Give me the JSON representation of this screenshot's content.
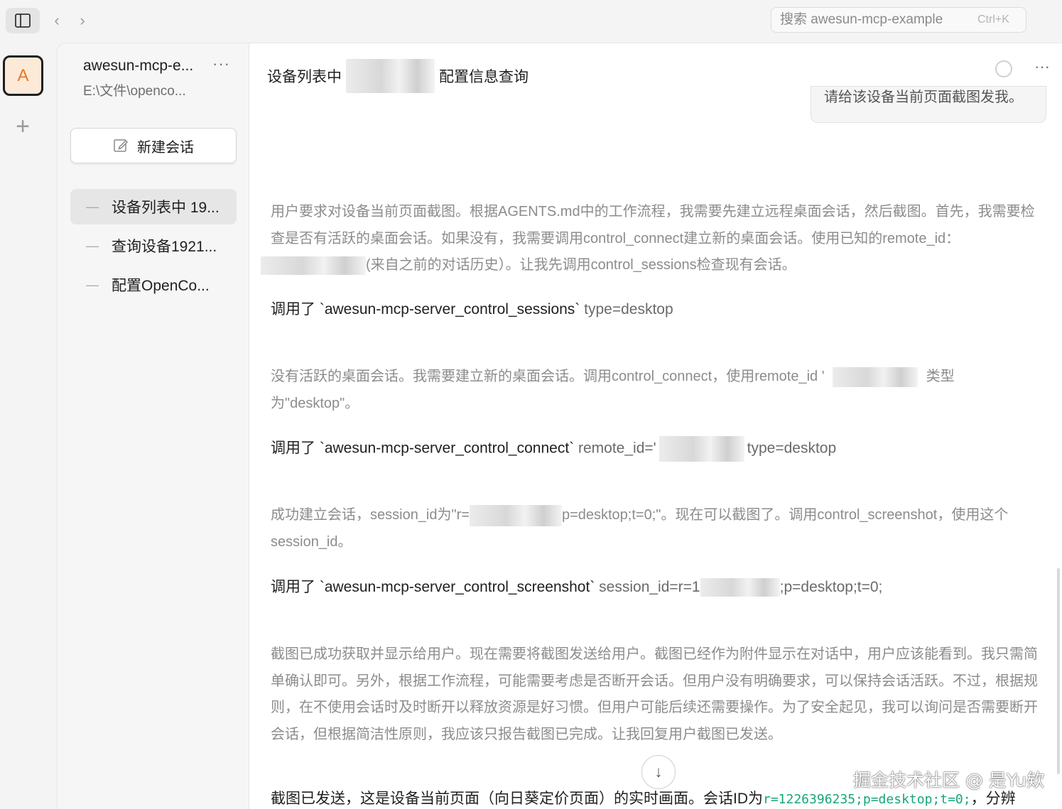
{
  "topbar": {
    "search_placeholder": "搜索 awesun-mcp-example",
    "search_shortcut": "Ctrl+K"
  },
  "rail": {
    "avatar_letter": "A",
    "add_label": "+"
  },
  "sidebar": {
    "project_name": "awesun-mcp-e...",
    "project_path": "E:\\文件\\openco...",
    "more": "···",
    "new_chat_label": "新建会话",
    "conversations": [
      {
        "label": "设备列表中 19..."
      },
      {
        "label": "查询设备1921..."
      },
      {
        "label": "配置OpenCo..."
      }
    ]
  },
  "main": {
    "title_prefix": "设备列表中",
    "title_suffix": "配置信息查询",
    "more": "···",
    "prev_message": "请给该设备当前页面截图发我。",
    "blocks": [
      {
        "think_a": "用户要求对设备当前页面截图。根据AGENTS.md中的工作流程，我需要先建立远程桌面会话，然后截图。首先，我需要检查是否有活跃的桌面会话。如果没有，我需要调用control_connect建立新的桌面会话。使用已知的remote_id：",
        "think_b": "(来自之前的对话历史）。让我先调用control_sessions检查现有会话。"
      },
      {
        "call": "调用了 `awesun-mcp-server_control_sessions`",
        "args": "type=desktop"
      },
      {
        "think_a": "没有活跃的桌面会话。我需要建立新的桌面会话。调用control_connect，使用remote_id '",
        "think_b": "类型为\"desktop\"。"
      },
      {
        "call": "调用了 `awesun-mcp-server_control_connect`",
        "args_a": "remote_id='",
        "args_b": "type=desktop"
      },
      {
        "think_a": "成功建立会话，session_id为\"r=",
        "think_b": "p=desktop;t=0;\"。现在可以截图了。调用control_screenshot，使用这个session_id。"
      },
      {
        "call": "调用了 `awesun-mcp-server_control_screenshot`",
        "args_a": "session_id=r=1",
        "args_b": ";p=desktop;t=0;"
      },
      {
        "think": "截图已成功获取并显示给用户。现在需要将截图发送给用户。截图已经作为附件显示在对话中，用户应该能看到。我只需简单确认即可。另外，根据工作流程，可能需要考虑是否断开会话。但用户没有明确要求，可以保持会话活跃。不过，根据规则，在不使用会话时及时断开以释放资源是好习惯。但用户可能后续还需要操作。为了安全起见，我可以询问是否需要断开会话，但根据简洁性原则，我应该只报告截图已完成。让我回复用户截图已发送。"
      }
    ],
    "final_text": "截图已发送，这是设备当前页面（向日葵定价页面）的实时画面。会话ID为",
    "final_code": "r=1226396235;p=desktop;t=0;",
    "final_tail": "，分辨",
    "watermark": "掘金技术社区 @ 是Yu欸"
  }
}
